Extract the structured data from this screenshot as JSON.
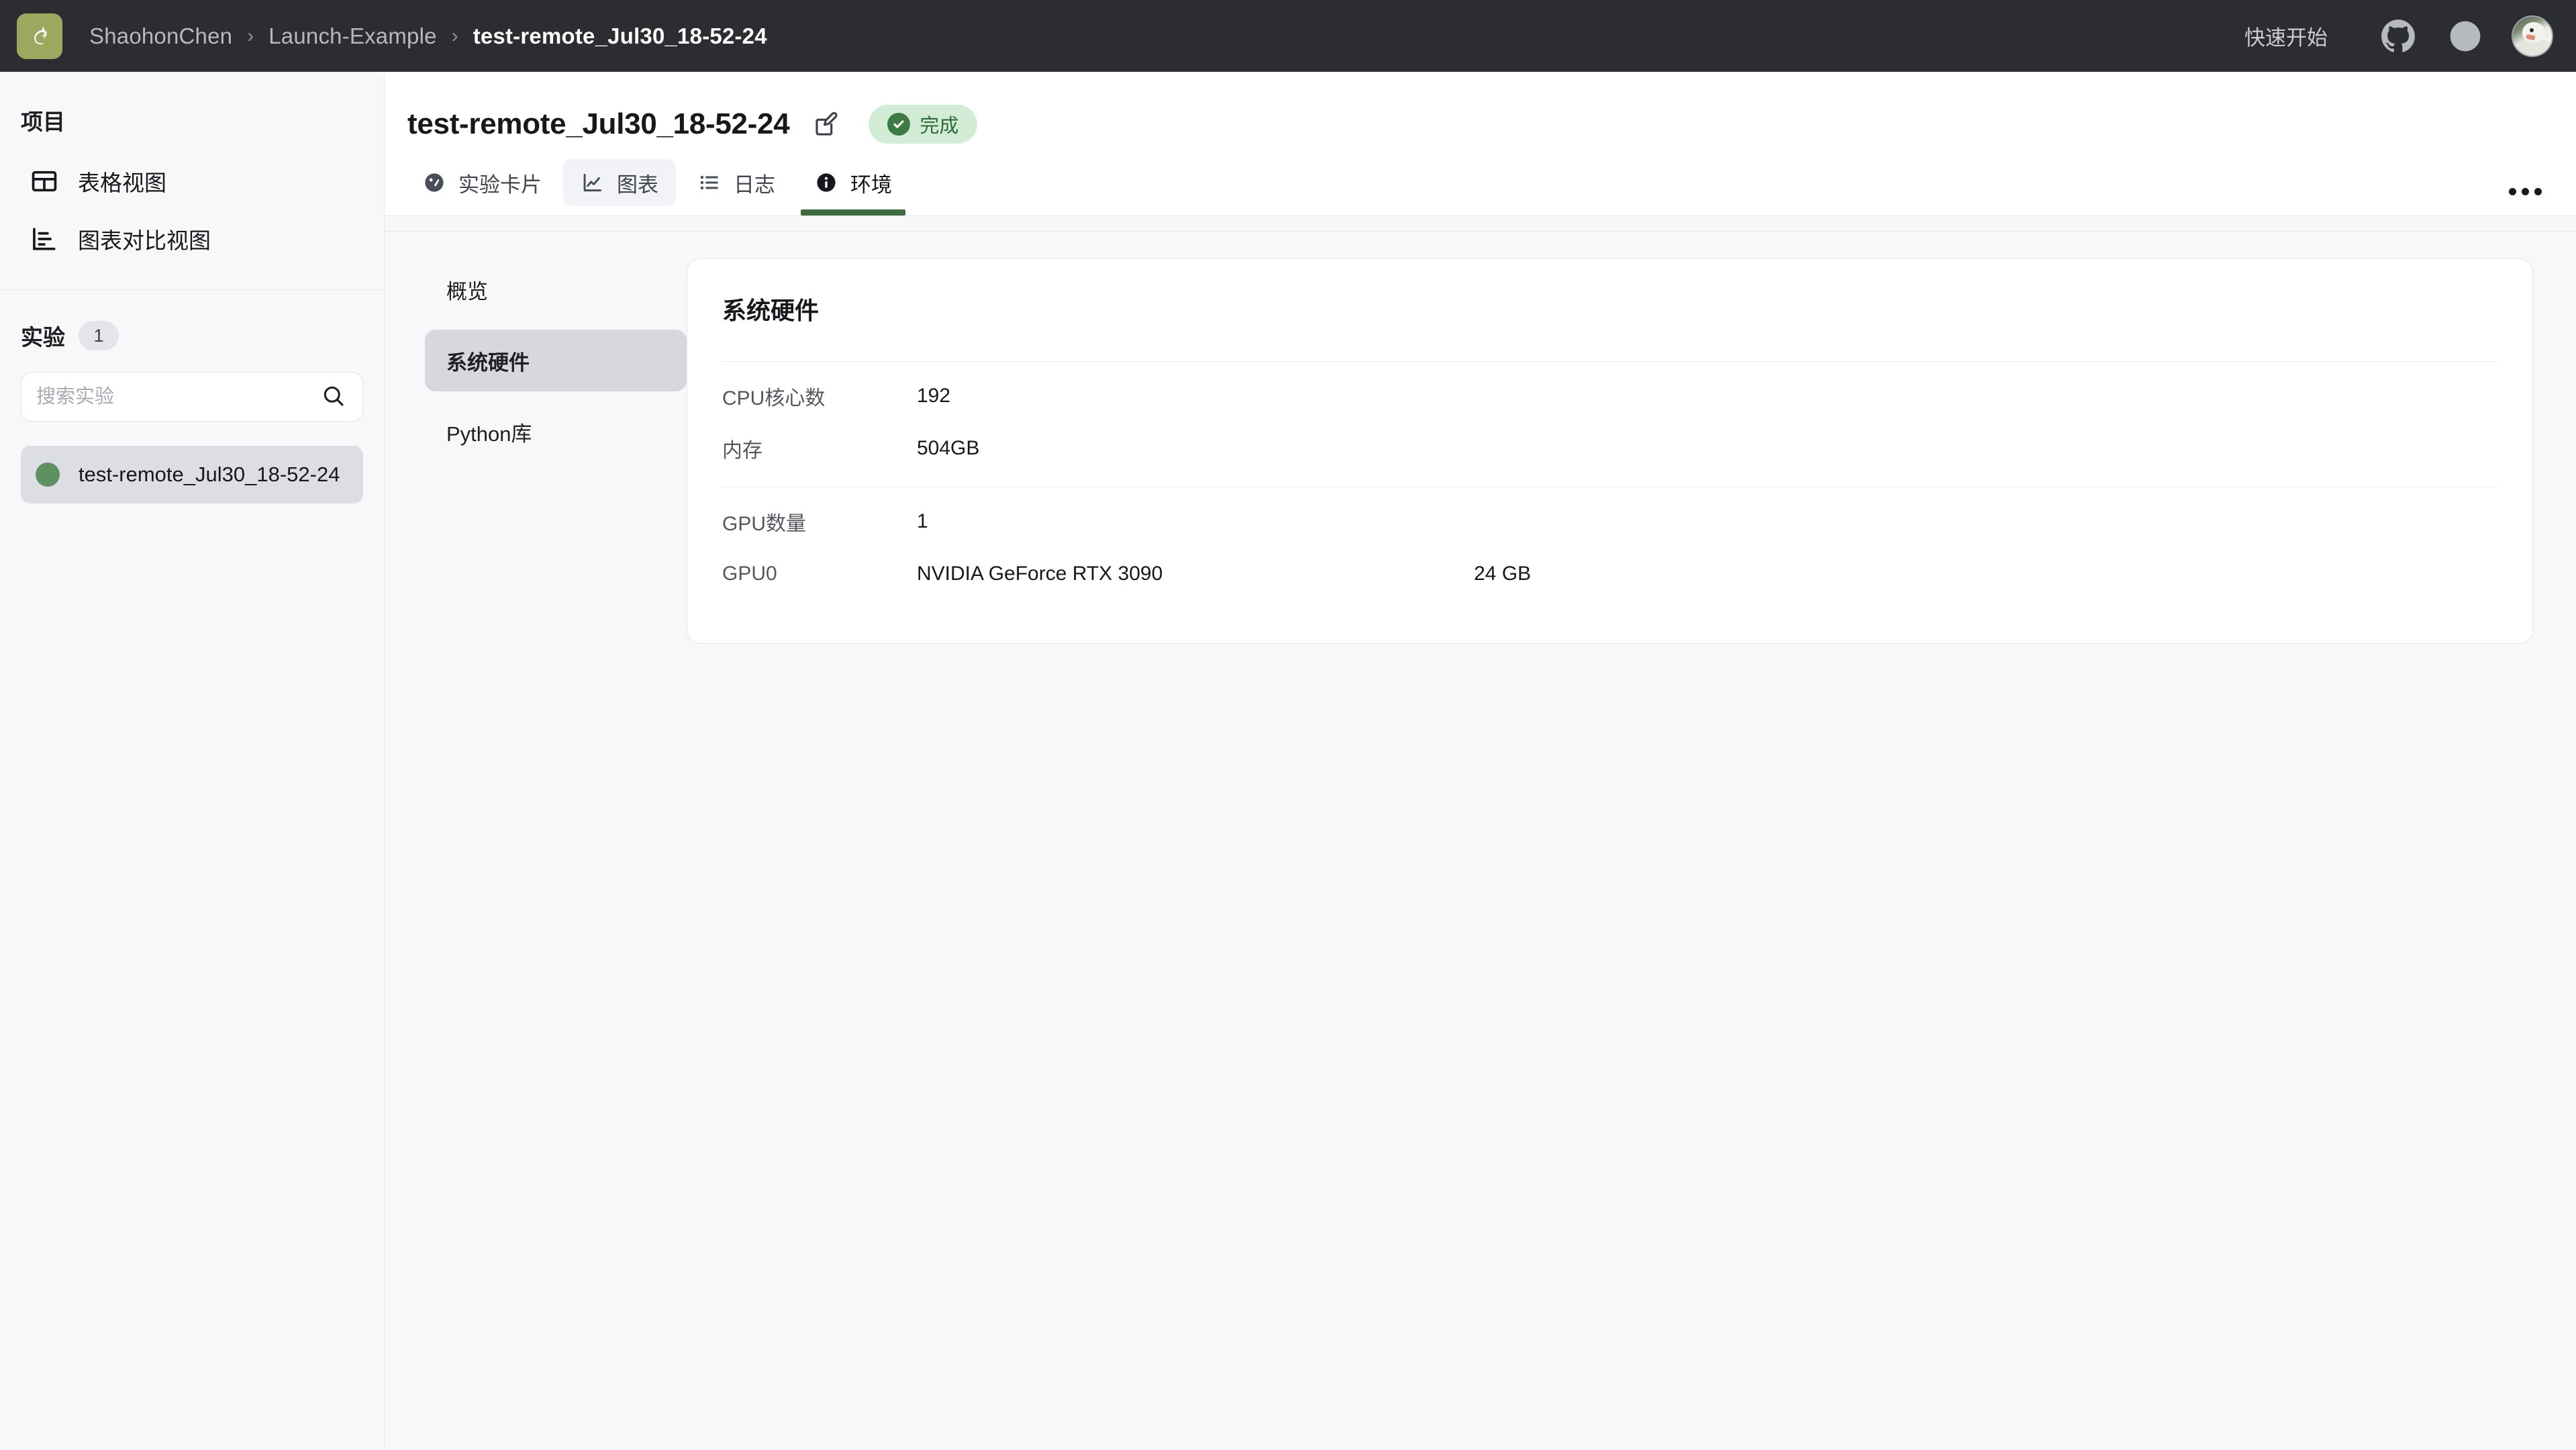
{
  "topbar": {
    "logo_name": "swanlab-logo",
    "breadcrumb": [
      {
        "label": "ShaohonChen",
        "active": false
      },
      {
        "label": "Launch-Example",
        "active": false
      },
      {
        "label": "test-remote_Jul30_18-52-24",
        "active": true
      }
    ],
    "separator": "›",
    "quickstart_label": "快速开始",
    "github_icon": "github-icon",
    "help_icon": "help-circle-icon",
    "avatar_icon": "user-avatar"
  },
  "sidebar": {
    "project_title": "项目",
    "nav": [
      {
        "label": "表格视图",
        "icon": "table-view-icon"
      },
      {
        "label": "图表对比视图",
        "icon": "chart-compare-icon"
      }
    ],
    "experiments_title": "实验",
    "experiments_count": "1",
    "search_placeholder": "搜索实验",
    "search_value": "",
    "search_icon": "search-icon",
    "experiments": [
      {
        "name": "test-remote_Jul30_18-52-24",
        "status_color": "#5f9060",
        "selected": true
      }
    ]
  },
  "main": {
    "run_title": "test-remote_Jul30_18-52-24",
    "edit_icon": "edit-pencil-icon",
    "status": {
      "label": "完成",
      "icon": "check-circle-icon",
      "bg_color": "#d3ecd5",
      "text_color": "#2f6b39"
    },
    "more_icon": "more-horizontal-icon",
    "tabs": [
      {
        "label": "实验卡片",
        "icon": "dashboard-icon",
        "active": false,
        "hovered": false
      },
      {
        "label": "图表",
        "icon": "line-chart-icon",
        "active": false,
        "hovered": true
      },
      {
        "label": "日志",
        "icon": "list-icon",
        "active": false,
        "hovered": false
      },
      {
        "label": "环境",
        "icon": "info-circle-icon",
        "active": true,
        "hovered": false
      }
    ],
    "active_tab_color": "#3e6b40",
    "subnav": [
      {
        "label": "概览",
        "active": false
      },
      {
        "label": "系统硬件",
        "active": true
      },
      {
        "label": "Python库",
        "active": false
      }
    ],
    "card": {
      "title": "系统硬件",
      "groups": [
        {
          "rows": [
            {
              "key": "CPU核心数",
              "value": "192",
              "value2": ""
            },
            {
              "key": "内存",
              "value": "504GB",
              "value2": ""
            }
          ]
        },
        {
          "rows": [
            {
              "key": "GPU数量",
              "value": "1",
              "value2": ""
            },
            {
              "key": "GPU0",
              "value": "NVIDIA GeForce RTX 3090",
              "value2": "24 GB"
            }
          ]
        }
      ]
    }
  }
}
